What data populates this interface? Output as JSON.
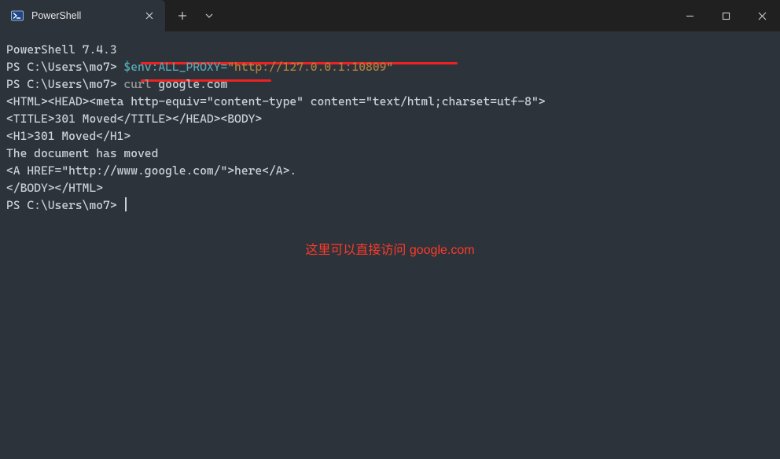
{
  "titlebar": {
    "tab_title": "PowerShell"
  },
  "terminal": {
    "version_line": "PowerShell 7.4.3",
    "prompt": "PS C:\\Users\\mo7>",
    "cmd1_var": "$env:ALL_PROXY",
    "cmd1_eq": "=",
    "cmd1_val": "\"http://127.0.0.1:10809\"",
    "cmd2_a": "curl",
    "cmd2_b": " google.com",
    "out1": "<HTML><HEAD><meta http-equiv=\"content-type\" content=\"text/html;charset=utf-8\">",
    "out2": "<TITLE>301 Moved</TITLE></HEAD><BODY>",
    "out3": "<H1>301 Moved</H1>",
    "out4": "The document has moved",
    "out5": "<A HREF=\"http://www.google.com/\">here</A>.",
    "out6": "</BODY></HTML>"
  },
  "annotation": "这里可以直接访问 google.com"
}
